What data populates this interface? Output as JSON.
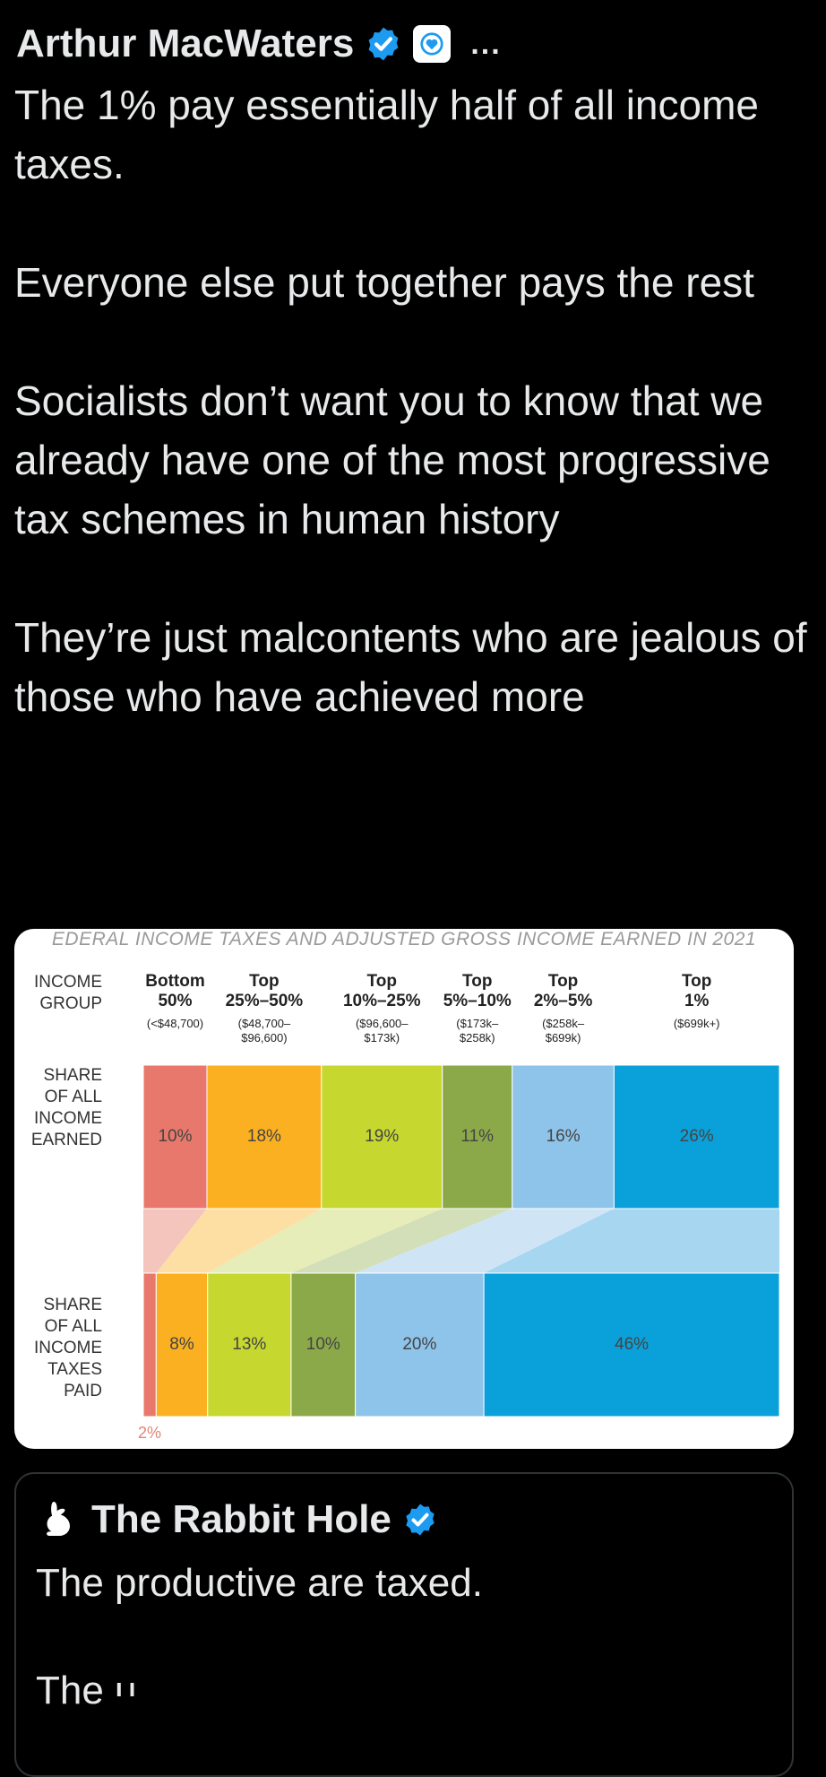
{
  "tweet": {
    "author": "Arthur MacWaters",
    "more": "...",
    "paragraphs": [
      "The 1% pay essentially half of all income taxes.",
      "Everyone else put together pays the rest",
      "Socialists don’t want you to know that we already have one of the most progressive tax schemes in human history",
      "They’re just malcontents who are jealous of those who have achieved more"
    ]
  },
  "chart_data": {
    "type": "bar",
    "title": "EDERAL INCOME TAXES AND ADJUSTED GROSS INCOME EARNED IN 2021",
    "row_headers": {
      "group": [
        "INCOME",
        "GROUP"
      ],
      "earned": [
        "SHARE",
        "OF ALL",
        "INCOME",
        "EARNED"
      ],
      "paid": [
        "SHARE",
        "OF ALL",
        "INCOME",
        "TAXES",
        "PAID"
      ]
    },
    "categories": [
      {
        "name": [
          "Bottom",
          "50%"
        ],
        "range": [
          "(<$48,700)"
        ]
      },
      {
        "name": [
          "Top",
          "25%–50%"
        ],
        "range": [
          "($48,700–",
          "$96,600)"
        ]
      },
      {
        "name": [
          "Top",
          "10%–25%"
        ],
        "range": [
          "($96,600–",
          "$173k)"
        ]
      },
      {
        "name": [
          "Top",
          "5%–10%"
        ],
        "range": [
          "($173k–",
          "$258k)"
        ]
      },
      {
        "name": [
          "Top",
          "2%–5%"
        ],
        "range": [
          "($258k–",
          "$699k)"
        ]
      },
      {
        "name": [
          "Top",
          "1%"
        ],
        "range": [
          "($699k+)"
        ]
      }
    ],
    "series": [
      {
        "name": "SHARE OF ALL INCOME EARNED",
        "values": [
          10,
          18,
          19,
          11,
          16,
          26
        ],
        "labels": [
          "10%",
          "18%",
          "19%",
          "11%",
          "16%",
          "26%"
        ]
      },
      {
        "name": "SHARE OF ALL INCOME TAXES PAID",
        "values": [
          2,
          8,
          13,
          10,
          20,
          46
        ],
        "labels": [
          "2%",
          "8%",
          "13%",
          "10%",
          "20%",
          "46%"
        ]
      }
    ],
    "colors": [
      "#e8786b",
      "#fbb022",
      "#c6d72f",
      "#8ca94a",
      "#8ec3ea",
      "#0aa0d9"
    ],
    "connector_colors": [
      "#f4c5bd",
      "#fddfa4",
      "#e6edb8",
      "#d3dfb9",
      "#cfe5f6",
      "#a7d6f0"
    ]
  },
  "quote": {
    "name": "The Rabbit Hole",
    "lines": [
      "The productive are taxed.",
      "The u"
    ]
  }
}
